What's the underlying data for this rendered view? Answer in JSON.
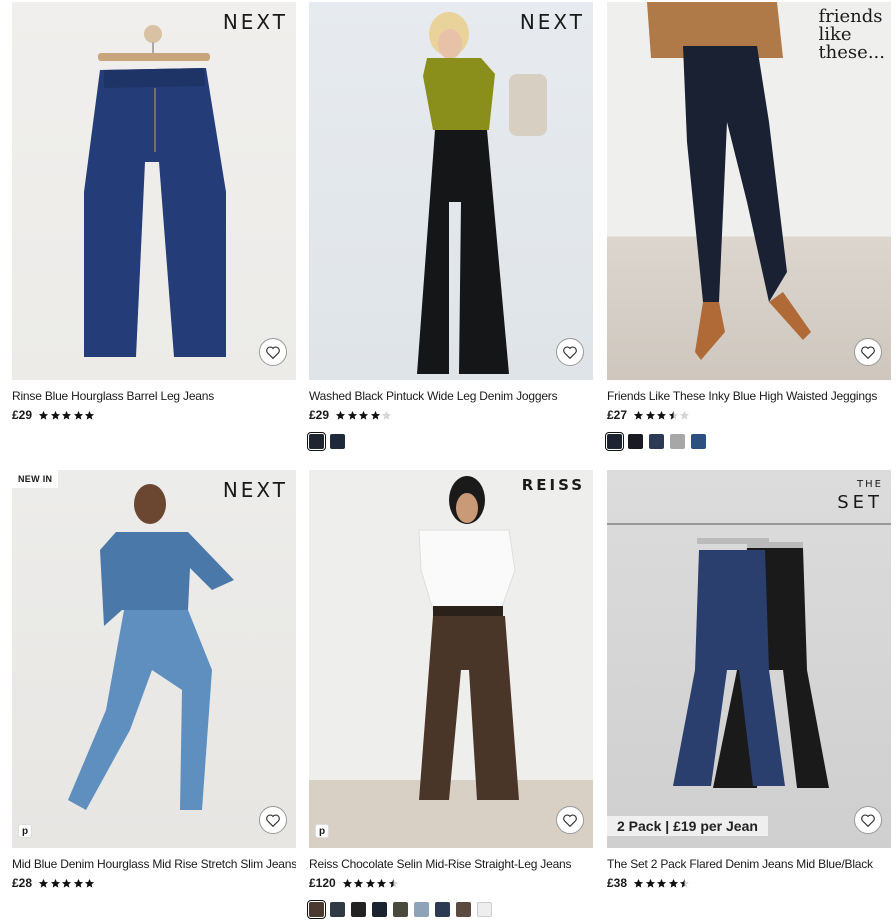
{
  "products": [
    {
      "brand": "NEXT",
      "title": "Rinse Blue Hourglass Barrel Leg Jeans",
      "price": "£29",
      "rating": 5,
      "swatches": []
    },
    {
      "brand": "NEXT",
      "title": "Washed Black Pintuck Wide Leg Denim Joggers",
      "price": "£29",
      "rating": 4,
      "swatches": [
        "#1f2630",
        "#1e2a3c"
      ]
    },
    {
      "brand_lines": [
        "friends",
        "like",
        "these..."
      ],
      "title": "Friends Like These Inky Blue High Waisted Jeggings",
      "price": "£27",
      "rating": 3.5,
      "swatches": [
        "#1d2330",
        "#1a1a22",
        "#2c3a55",
        "#a7a7a7",
        "#2d4f80"
      ]
    },
    {
      "badge": "NEW IN",
      "brand": "NEXT",
      "title": "Mid Blue Denim Hourglass Mid Rise Stretch Slim Jeans",
      "price": "£28",
      "rating": 5,
      "pay_badge": "p",
      "swatches": []
    },
    {
      "brand": "REISS",
      "title": "Reiss Chocolate Selin Mid-Rise Straight-Leg Jeans",
      "price": "£120",
      "rating": 4.5,
      "pay_badge": "p",
      "swatches": [
        "#4a3a30",
        "#2f3a45",
        "#222222",
        "#1b2230",
        "#4a4a3c",
        "#8fa3b8",
        "#2c3a52",
        "#5b4a40",
        "#eeeeee"
      ]
    },
    {
      "brand_small": "THE",
      "brand": "SET",
      "promo": "2 Pack | £19 per Jean",
      "title": "The Set 2 Pack Flared Denim Jeans Mid Blue/Black",
      "price": "£38",
      "rating": 4.5,
      "swatches": []
    }
  ],
  "colors": {
    "star": "#111111",
    "star_empty": "#d5d5d5"
  },
  "icons": {
    "favourite": "heart-icon",
    "rating": "star-icon"
  }
}
